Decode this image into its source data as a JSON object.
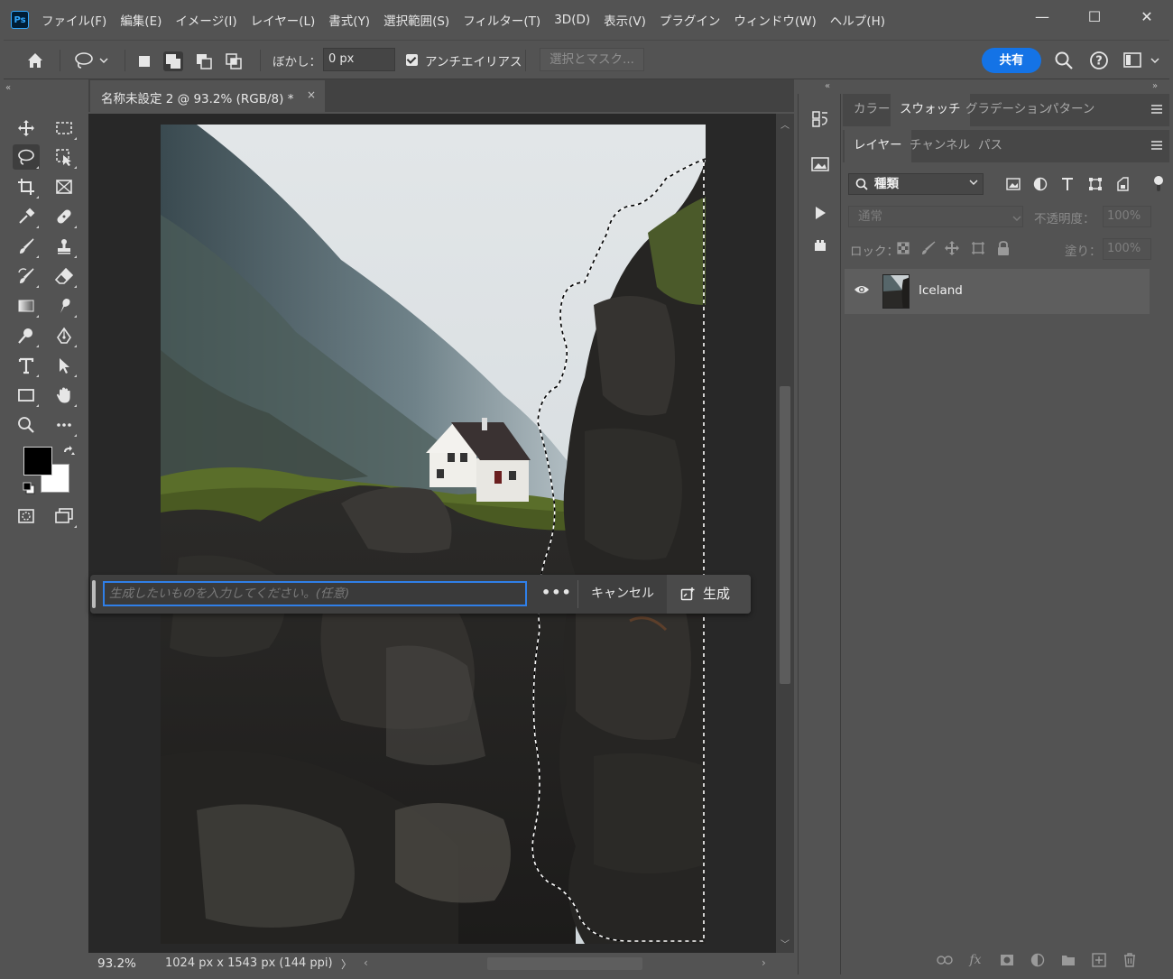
{
  "app": {
    "logo": "Ps",
    "menu": [
      "ファイル(F)",
      "編集(E)",
      "イメージ(I)",
      "レイヤー(L)",
      "書式(Y)",
      "選択範囲(S)",
      "フィルター(T)",
      "3D(D)",
      "表示(V)",
      "プラグイン",
      "ウィンドウ(W)",
      "ヘルプ(H)"
    ],
    "window_controls": {
      "minimize": "—",
      "maximize": "☐",
      "close": "✕"
    }
  },
  "options": {
    "feather_label": "ぼかし：",
    "feather_value": "0 px",
    "antialias_label": "アンチエイリアス",
    "antialias_checked": true,
    "select_mask_label": "選択とマスク...",
    "share_label": "共有"
  },
  "toolbar": {
    "collapse": "«",
    "active_tool": "lasso-tool",
    "foreground_color": "#000000",
    "background_color": "#ffffff"
  },
  "document": {
    "tab_title": "名称未設定 2 @ 93.2% (RGB/8) *",
    "tab_close": "×"
  },
  "generative_fill": {
    "placeholder": "生成したいものを入力してください。(任意)",
    "more": "•••",
    "cancel_label": "キャンセル",
    "generate_label": "生成"
  },
  "status": {
    "zoom": "93.2%",
    "doc_info": "1024 px x 1543 px (144 ppi)",
    "arrow": "〉",
    "scroll_left": "‹",
    "scroll_right": "›"
  },
  "panels": {
    "collapse_left": "«",
    "collapse_right": "»",
    "swatch_tabs": [
      "カラー",
      "スウォッチ",
      "グラデーション",
      "パターン"
    ],
    "swatch_active": 1,
    "layer_tabs": [
      "レイヤー",
      "チャンネル",
      "パス"
    ],
    "layer_active": 0
  },
  "layers": {
    "filter_label": "種類",
    "blend_mode": "通常",
    "opacity_label": "不透明度：",
    "opacity_value": "100%",
    "lock_label": "ロック：",
    "fill_label": "塗り：",
    "fill_value": "100%",
    "items": [
      {
        "name": "Iceland",
        "visible": true
      }
    ]
  },
  "colors": {
    "accent": "#1473e6",
    "selection_border": "#2f7fe8",
    "app_bg": "#535353",
    "canvas_bg": "#282828"
  }
}
